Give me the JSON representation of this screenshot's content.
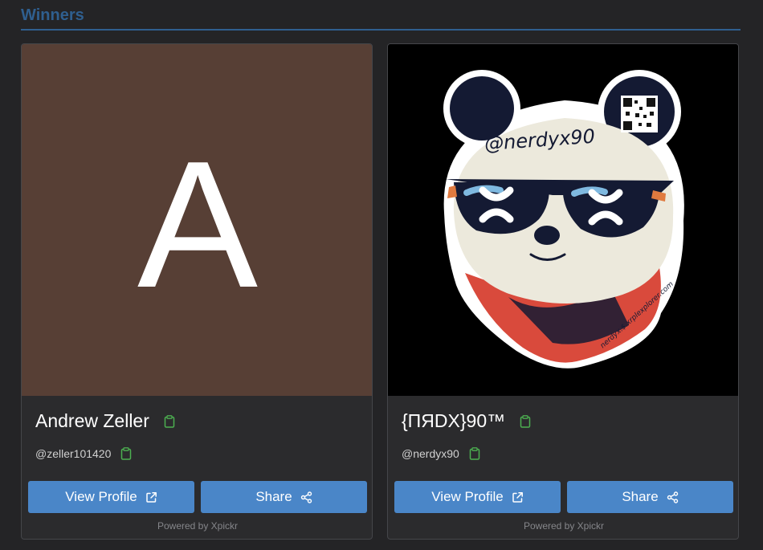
{
  "section": {
    "title": "Winners"
  },
  "winners": [
    {
      "avatar_initial": "A",
      "avatar_color": "#573f35",
      "name": "Andrew Zeller",
      "handle": "@zeller101420",
      "view_label": "View Profile",
      "share_label": "Share",
      "powered": "Powered by Xpickr"
    },
    {
      "avatar_image": "panda-sticker",
      "avatar_caption": "@nerdyx90",
      "avatar_side_text": "nerdyx.$.xrplexplorer.com",
      "name": "{ΠЯDX}90™",
      "handle": "@nerdyx90",
      "view_label": "View Profile",
      "share_label": "Share",
      "powered": "Powered by Xpickr"
    }
  ],
  "colors": {
    "accent": "#4a86c8",
    "title": "#2f5f8f",
    "copy_icon": "#4caf50",
    "background": "#242426",
    "card": "#2b2b2d"
  },
  "icons": {
    "copy": "clipboard-icon",
    "external": "external-link-icon",
    "share": "share-icon"
  }
}
